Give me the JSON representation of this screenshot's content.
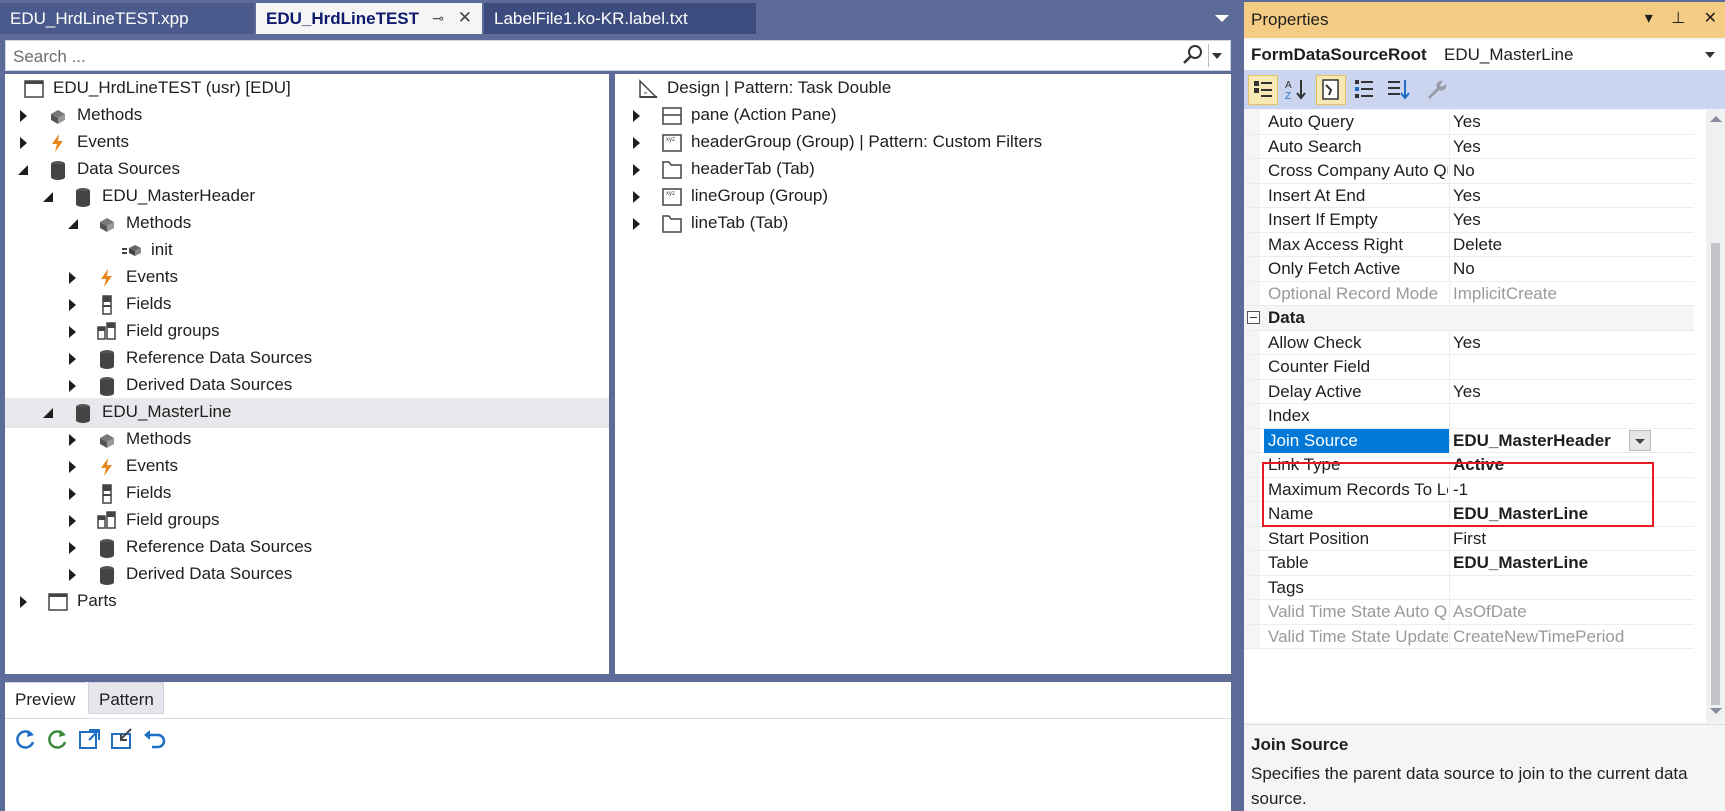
{
  "tabs": [
    {
      "label": "EDU_HrdLineTEST.xpp"
    },
    {
      "label": "EDU_HrdLineTEST",
      "pin": "⊸",
      "close": "✕"
    },
    {
      "label": "LabelFile1.ko-KR.label.txt"
    }
  ],
  "search": {
    "placeholder": "Search ..."
  },
  "tree": {
    "root": "EDU_HrdLineTEST (usr) [EDU]",
    "items": [
      {
        "label": "Methods",
        "icon": "methods-icon"
      },
      {
        "label": "Events",
        "icon": "lightning-icon"
      },
      {
        "label": "Data Sources",
        "icon": "database-icon"
      },
      {
        "label": "EDU_MasterHeader",
        "icon": "database-icon"
      },
      {
        "label": "Methods",
        "icon": "methods-icon"
      },
      {
        "label": "init",
        "icon": "method-icon"
      },
      {
        "label": "Events",
        "icon": "lightning-icon"
      },
      {
        "label": "Fields",
        "icon": "fields-icon"
      },
      {
        "label": "Field groups",
        "icon": "field-groups-icon"
      },
      {
        "label": "Reference Data Sources",
        "icon": "database-icon"
      },
      {
        "label": "Derived Data Sources",
        "icon": "database-icon"
      },
      {
        "label": "EDU_MasterLine",
        "icon": "database-icon"
      },
      {
        "label": "Methods",
        "icon": "methods-icon"
      },
      {
        "label": "Events",
        "icon": "lightning-icon"
      },
      {
        "label": "Fields",
        "icon": "fields-icon"
      },
      {
        "label": "Field groups",
        "icon": "field-groups-icon"
      },
      {
        "label": "Reference Data Sources",
        "icon": "database-icon"
      },
      {
        "label": "Derived Data Sources",
        "icon": "database-icon"
      },
      {
        "label": "Parts",
        "icon": "parts-icon"
      }
    ]
  },
  "design": {
    "root": "Design | Pattern: Task Double",
    "items": [
      {
        "label": "pane (Action Pane)"
      },
      {
        "label": "headerGroup (Group) | Pattern: Custom Filters"
      },
      {
        "label": "headerTab (Tab)"
      },
      {
        "label": "lineGroup (Group)"
      },
      {
        "label": "lineTab (Tab)"
      }
    ]
  },
  "bottom": {
    "tabs": [
      {
        "label": "Preview"
      },
      {
        "label": "Pattern"
      }
    ]
  },
  "properties": {
    "title": "Properties",
    "object_type": "FormDataSourceRoot",
    "object_name": "EDU_MasterLine",
    "rows": [
      {
        "name": "Auto Query",
        "value": "Yes"
      },
      {
        "name": "Auto Search",
        "value": "Yes"
      },
      {
        "name": "Cross Company Auto Query",
        "value": "No"
      },
      {
        "name": "Insert At End",
        "value": "Yes"
      },
      {
        "name": "Insert If Empty",
        "value": "Yes"
      },
      {
        "name": "Max Access Right",
        "value": "Delete"
      },
      {
        "name": "Only Fetch Active",
        "value": "No"
      },
      {
        "name": "Optional Record Mode",
        "value": "ImplicitCreate"
      },
      {
        "name": "Data",
        "value": ""
      },
      {
        "name": "Allow Check",
        "value": "Yes"
      },
      {
        "name": "Counter Field",
        "value": ""
      },
      {
        "name": "Delay Active",
        "value": "Yes"
      },
      {
        "name": "Index",
        "value": ""
      },
      {
        "name": "Join Source",
        "value": "EDU_MasterHeader"
      },
      {
        "name": "Link Type",
        "value": "Active"
      },
      {
        "name": "Maximum Records To Load",
        "value": "-1"
      },
      {
        "name": "Name",
        "value": "EDU_MasterLine"
      },
      {
        "name": "Start Position",
        "value": "First"
      },
      {
        "name": "Table",
        "value": "EDU_MasterLine"
      },
      {
        "name": "Tags",
        "value": ""
      },
      {
        "name": "Valid Time State Auto Query",
        "value": "AsOfDate"
      },
      {
        "name": "Valid Time State Update",
        "value": "CreateNewTimePeriod"
      }
    ],
    "description": {
      "title": "Join Source",
      "text": "Specifies the parent data source to join to the current data source."
    }
  },
  "colors": {
    "accent": "#0078d7",
    "highlight": "#e51c23",
    "header": "#f5cc84",
    "chrome": "#5d6b99"
  }
}
